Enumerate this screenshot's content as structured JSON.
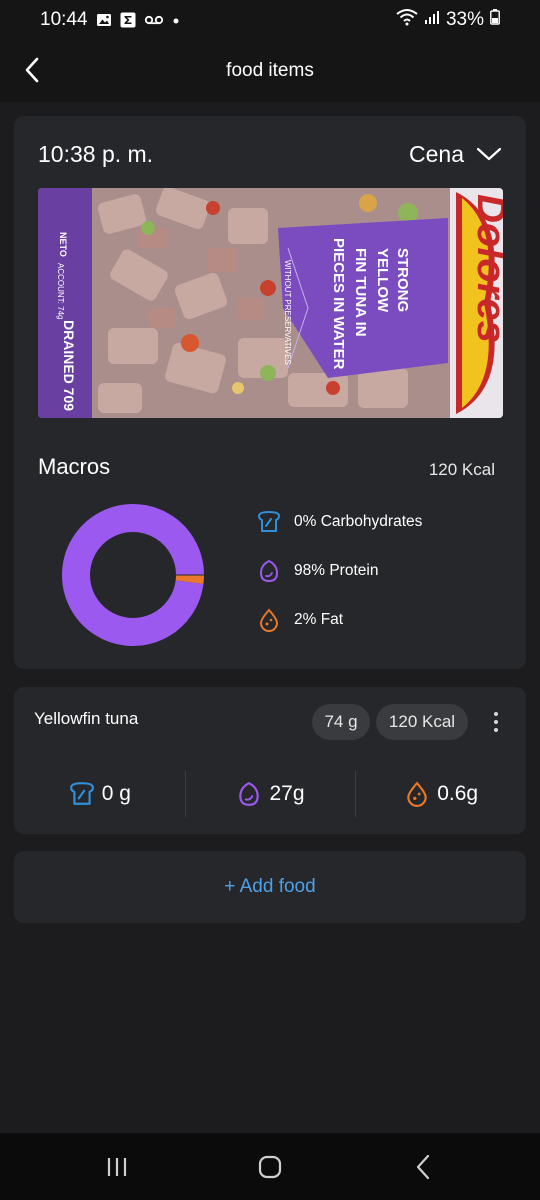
{
  "status_bar": {
    "time": "10:44",
    "battery": "33%",
    "icons": [
      "gallery-icon",
      "sigma-icon",
      "voicemail-icon",
      "dot-icon",
      "wifi-icon",
      "signal-icon",
      "battery-icon"
    ]
  },
  "header": {
    "title": "food items",
    "back_icon": "chevron-left-icon"
  },
  "meal": {
    "time": "10:38 p. m.",
    "meal_type": "Cena",
    "photo_icon": "food-photo",
    "photo_text": {
      "brand": "Dolores",
      "line1": "STRONG",
      "line2": "YELLOW",
      "line3": "FIN TUNA IN",
      "line4": "PIECES IN WATER",
      "small": "WITHOUT PRESERVATIVES",
      "side1": "DRAINED 709",
      "side2": "ACCOUNT: 74g",
      "side3": "NETO"
    }
  },
  "macros": {
    "title": "Macros",
    "kcal": "120 Kcal",
    "items": [
      {
        "label": "0% Carbohydrates",
        "icon": "bread-icon",
        "color": "#2f8fd8",
        "percent": 0
      },
      {
        "label": "98% Protein",
        "icon": "egg-icon",
        "color": "#9b59f0",
        "percent": 98
      },
      {
        "label": "2% Fat",
        "icon": "fat-drop-icon",
        "color": "#e8782a",
        "percent": 2
      }
    ]
  },
  "food_item": {
    "name": "Yellowfin tuna",
    "grams": "74 g",
    "kcal": "120 Kcal",
    "more_icon": "more-vertical-icon",
    "carbs": "0 g",
    "protein": "27g",
    "fat": "0.6g"
  },
  "add_food": {
    "label": "+ Add food"
  },
  "nav_bar": {
    "icons": [
      "recent-apps-icon",
      "home-icon",
      "back-icon"
    ]
  },
  "colors": {
    "background": "#1c1c1e",
    "card": "#26272a",
    "accent_blue": "#4ea0e8",
    "protein": "#9b59f0",
    "fat": "#e8782a",
    "carbs": "#2f8fd8"
  }
}
